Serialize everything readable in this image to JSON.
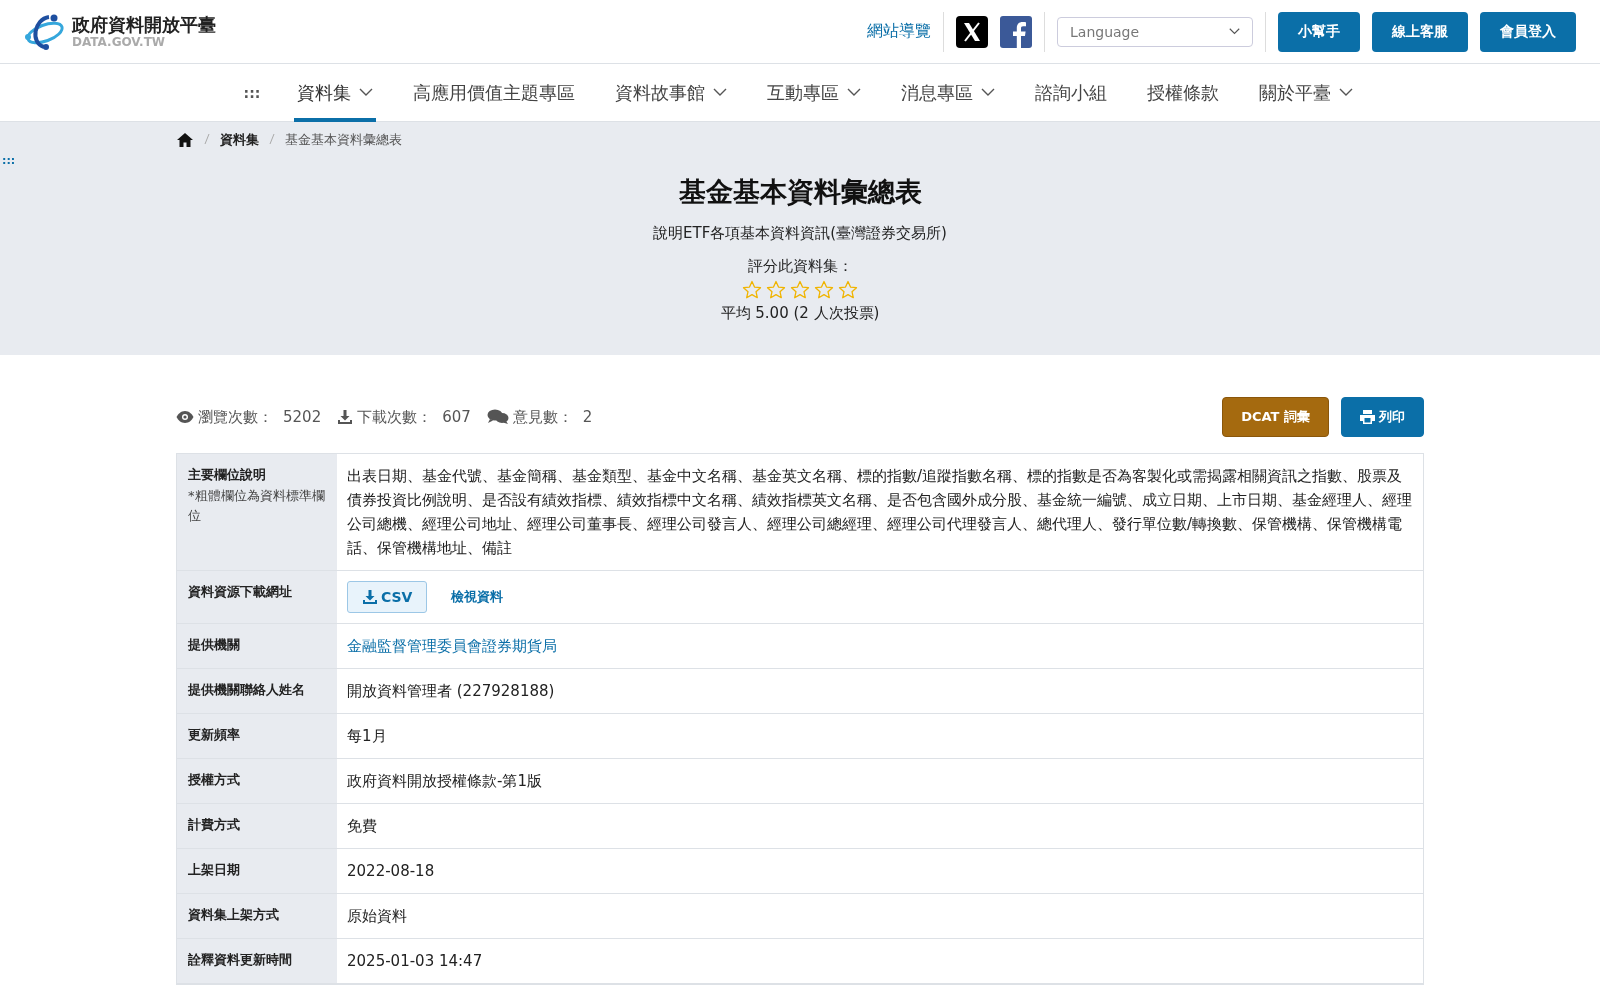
{
  "header": {
    "logo_title": "政府資料開放平臺",
    "logo_subtitle": "DATA.GOV.TW",
    "sitemap_link": "網站導覽",
    "language": {
      "placeholder": "Language"
    },
    "buttons": [
      "小幫手",
      "線上客服",
      "會員登入"
    ]
  },
  "nav": {
    "accesskey": ":::",
    "items": [
      {
        "label": "資料集",
        "dropdown": true,
        "selected": true
      },
      {
        "label": "高應用價值主題專區",
        "dropdown": false,
        "selected": false
      },
      {
        "label": "資料故事館",
        "dropdown": true,
        "selected": false
      },
      {
        "label": "互動專區",
        "dropdown": true,
        "selected": false
      },
      {
        "label": "消息專區",
        "dropdown": true,
        "selected": false
      },
      {
        "label": "諮詢小組",
        "dropdown": false,
        "selected": false
      },
      {
        "label": "授權條款",
        "dropdown": false,
        "selected": false
      },
      {
        "label": "關於平臺",
        "dropdown": true,
        "selected": false
      }
    ]
  },
  "breadcrumb": [
    {
      "label": "資料集",
      "kind": "link"
    },
    {
      "label": "基金基本資料彙總表",
      "kind": "current"
    }
  ],
  "side_accesskey": ":::",
  "dataset": {
    "title": "基金基本資料彙總表",
    "description": "說明ETF各項基本資料資訊(臺灣證券交易所)",
    "rate_prompt": "評分此資料集：",
    "stars": 0,
    "average": "平均 5.00 (2 人次投票)"
  },
  "stats": [
    {
      "kind": "views",
      "label": "瀏覽次數：",
      "value": "5202"
    },
    {
      "kind": "downloads",
      "label": "下載次數：",
      "value": "607"
    },
    {
      "kind": "comments",
      "label": "意見數：",
      "value": "2"
    }
  ],
  "actions": [
    {
      "kind": "dcat",
      "label": "DCAT 詞彙"
    },
    {
      "kind": "print",
      "label": "列印"
    }
  ],
  "table": {
    "rows": [
      {
        "label": "主要欄位說明",
        "note": "*粗體欄位為資料標準欄位",
        "kind": "text",
        "value": "出表日期、基金代號、基金簡稱、基金類型、基金中文名稱、基金英文名稱、標的指數/追蹤指數名稱、標的指數是否為客製化或需揭露相關資訊之指數、股票及債券投資比例說明、是否設有績效指標、績效指標中文名稱、績效指標英文名稱、是否包含國外成分股、基金統一編號、成立日期、上市日期、基金經理人、經理公司總機、經理公司地址、經理公司董事長、經理公司發言人、經理公司總經理、經理公司代理發言人、總代理人、發行單位數/轉換數、保管機構、保管機構電話、保管機構地址、備註"
      },
      {
        "label": "資料資源下載網址",
        "kind": "downloads",
        "format": "CSV",
        "preview": "檢視資料"
      },
      {
        "label": "提供機關",
        "kind": "link",
        "value": "金融監督管理委員會證券期貨局"
      },
      {
        "label": "提供機關聯絡人姓名",
        "kind": "text",
        "value": "開放資料管理者 (227928188)"
      },
      {
        "label": "更新頻率",
        "kind": "text",
        "value": "每1月"
      },
      {
        "label": "授權方式",
        "kind": "text",
        "value": "政府資料開放授權條款-第1版"
      },
      {
        "label": "計費方式",
        "kind": "text",
        "value": "免費"
      },
      {
        "label": "上架日期",
        "kind": "text",
        "value": "2022-08-18"
      },
      {
        "label": "資料集上架方式",
        "kind": "text",
        "value": "原始資料"
      },
      {
        "label": "詮釋資料更新時間",
        "kind": "text",
        "value": "2025-01-03 14:47"
      }
    ]
  }
}
